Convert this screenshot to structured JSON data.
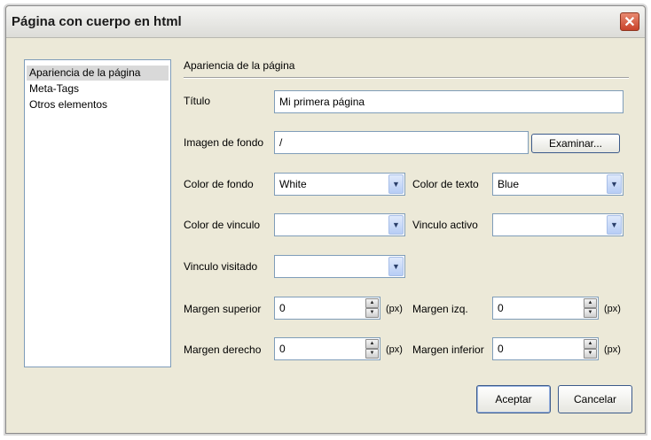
{
  "window": {
    "title": "Página con cuerpo en html"
  },
  "sidebar": {
    "items": [
      {
        "label": "Apariencia de la página",
        "selected": true
      },
      {
        "label": "Meta-Tags",
        "selected": false
      },
      {
        "label": "Otros elementos",
        "selected": false
      }
    ]
  },
  "section": {
    "header": "Apariencia de la página"
  },
  "fields": {
    "titulo": {
      "label": "Título",
      "value": "Mi primera página"
    },
    "imagen": {
      "label": "Imagen de fondo",
      "value": "/",
      "browse_label": "Examinar..."
    },
    "color_fondo": {
      "label": "Color de fondo",
      "value": "White"
    },
    "color_texto": {
      "label": "Color de texto",
      "value": "Blue"
    },
    "color_vinculo": {
      "label": "Color de vinculo",
      "value": ""
    },
    "vinculo_activo": {
      "label": "Vinculo activo",
      "value": ""
    },
    "vinculo_visitado": {
      "label": "Vinculo visitado",
      "value": ""
    },
    "margen_superior": {
      "label": "Margen superior",
      "value": "0",
      "unit": "(px)"
    },
    "margen_izq": {
      "label": "Margen izq.",
      "value": "0",
      "unit": "(px)"
    },
    "margen_derecho": {
      "label": "Margen derecho",
      "value": "0",
      "unit": "(px)"
    },
    "margen_inferior": {
      "label": "Margen inferior",
      "value": "0",
      "unit": "(px)"
    }
  },
  "buttons": {
    "ok": "Aceptar",
    "cancel": "Cancelar"
  },
  "colors": {
    "dialog_bg": "#ece9d8",
    "close_button": "#c9422a",
    "input_border": "#7f9db9"
  },
  "icons": {
    "close": "close-icon",
    "dropdown": "chevron-down-icon",
    "spinner": "spinner-arrows-icon"
  }
}
